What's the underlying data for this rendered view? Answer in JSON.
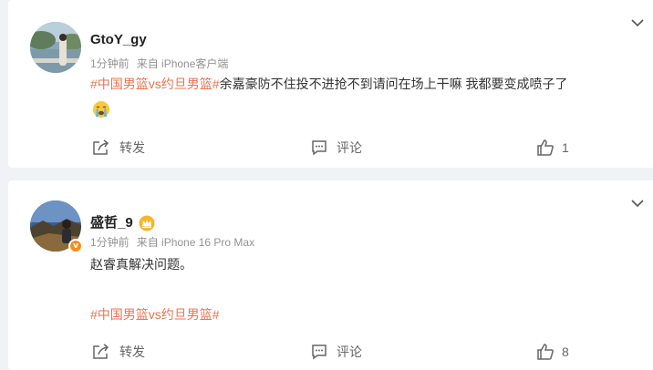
{
  "posts": [
    {
      "username": "GtoY_gy",
      "time": "1分钟前",
      "source": "来自 iPhone客户端",
      "hashtag": "#中国男篮vs约旦男篮#",
      "text": "余嘉豪防不住投不进抢不到请问在场上干嘛 我都要变成喷子了",
      "emoji": "crying-face",
      "repost_label": "转发",
      "comment_label": "评论",
      "like_count": "1"
    },
    {
      "username": "盛哲_9",
      "time": "1分钟前",
      "source": "来自 iPhone 16 Pro Max",
      "text": "赵睿真解决问题。",
      "hashtag": "#中国男篮vs约旦男篮#",
      "verified_badge": "v",
      "repost_label": "转发",
      "comment_label": "评论",
      "like_count": "8"
    }
  ],
  "colors": {
    "hashtag": "#eb7350",
    "meta": "#939393",
    "background": "#f1f2f5",
    "verified": "#f78c1e"
  }
}
